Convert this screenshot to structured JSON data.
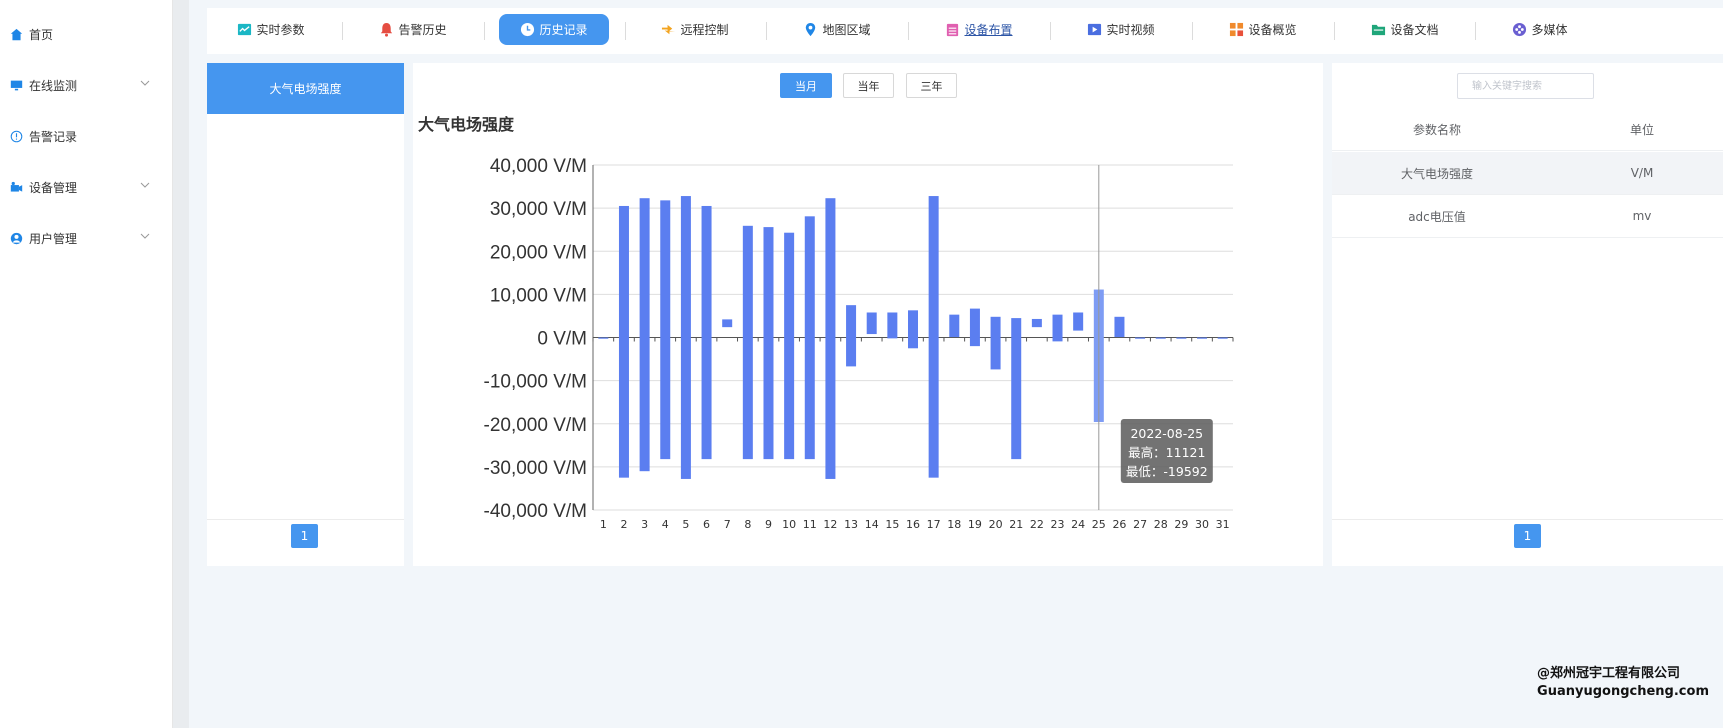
{
  "sidebar": {
    "items": [
      {
        "label": "首页",
        "icon": "home-icon",
        "has_arrow": false
      },
      {
        "label": "在线监测",
        "icon": "monitor-icon",
        "has_arrow": true
      },
      {
        "label": "告警记录",
        "icon": "info-circle-icon",
        "has_arrow": false
      },
      {
        "label": "设备管理",
        "icon": "device-icon",
        "has_arrow": true
      },
      {
        "label": "用户管理",
        "icon": "user-icon",
        "has_arrow": true
      }
    ]
  },
  "toolbar": {
    "tabs": [
      {
        "label": "实时参数",
        "icon": "realtime-params-icon",
        "color": "#1bb7c5"
      },
      {
        "label": "告警历史",
        "icon": "alarm-bell-icon",
        "color": "#e54d42"
      },
      {
        "label": "历史记录",
        "icon": "clock-icon",
        "color": "#ffffff",
        "active": true
      },
      {
        "label": "远程控制",
        "icon": "remote-control-icon",
        "color": "#f3a420"
      },
      {
        "label": "地图区域",
        "icon": "map-pin-icon",
        "color": "#1f86e6"
      },
      {
        "label": "设备布置",
        "icon": "calendar-icon",
        "color": "#e05fb0",
        "underline": true
      },
      {
        "label": "实时视频",
        "icon": "video-icon",
        "color": "#4a6ee0"
      },
      {
        "label": "设备概览",
        "icon": "grid-icon",
        "color": "#f08a2c"
      },
      {
        "label": "设备文档",
        "icon": "folder-icon",
        "color": "#1fa67a"
      },
      {
        "label": "多媒体",
        "icon": "multimedia-icon",
        "color": "#6a5fd1"
      }
    ]
  },
  "left_panel": {
    "items": [
      "大气电场强度"
    ],
    "page": "1"
  },
  "center_panel": {
    "range_buttons": [
      "当月",
      "当年",
      "三年"
    ],
    "active_range": "当月",
    "chart_title": "大气电场强度"
  },
  "right_panel": {
    "search_placeholder": "输入关键字搜索",
    "columns": [
      "参数名称",
      "单位"
    ],
    "rows": [
      {
        "name": "大气电场强度",
        "unit": "V/M",
        "selected": true
      },
      {
        "name": "adc电压值",
        "unit": "mv",
        "selected": false
      }
    ],
    "page": "1"
  },
  "watermark": {
    "line1": "@郑州冠宇工程有限公司",
    "line2": "Guanyugongcheng.com"
  },
  "chart_data": {
    "type": "bar",
    "subtype": "floating-range",
    "title": "大气电场强度",
    "categories": [
      "1",
      "2",
      "3",
      "4",
      "5",
      "6",
      "7",
      "8",
      "9",
      "10",
      "11",
      "12",
      "13",
      "14",
      "15",
      "16",
      "17",
      "18",
      "19",
      "20",
      "21",
      "22",
      "23",
      "24",
      "25",
      "26",
      "27",
      "28",
      "29",
      "30",
      "31"
    ],
    "series": [
      {
        "name": "最高",
        "values": [
          0,
          30500,
          32300,
          31800,
          32800,
          30500,
          4200,
          25900,
          25600,
          24300,
          28100,
          32300,
          7500,
          5800,
          5800,
          6300,
          32800,
          5300,
          6700,
          4800,
          4500,
          4300,
          5300,
          5800,
          11121,
          4800,
          0,
          0,
          0,
          0,
          0
        ]
      },
      {
        "name": "最低",
        "values": [
          0,
          -32500,
          -31000,
          -28200,
          -32800,
          -28200,
          2400,
          -28200,
          -28200,
          -28200,
          -28200,
          -32800,
          -6700,
          800,
          -200,
          -2500,
          -32500,
          100,
          -2000,
          -7400,
          -28200,
          2400,
          -900,
          1600,
          -19592,
          100,
          0,
          0,
          0,
          0,
          0
        ]
      }
    ],
    "ytick_labels": [
      "40,000 V/M",
      "30,000 V/M",
      "20,000 V/M",
      "10,000 V/M",
      "0 V/M",
      "-10,000 V/M",
      "-20,000 V/M",
      "-30,000 V/M",
      "-40,000 V/M"
    ],
    "ylim": [
      -40000,
      40000
    ],
    "yticks": [
      40000,
      30000,
      20000,
      10000,
      0,
      -10000,
      -20000,
      -30000,
      -40000
    ],
    "grid": true,
    "bar_color": "#5b7ef0",
    "highlight_color": "#7e9cf4",
    "tooltip": {
      "category_index": 24,
      "date": "2022-08-25",
      "max_label": "最高：11121",
      "min_label": "最低：-19592"
    }
  },
  "colors": {
    "accent": "#4596ef",
    "page_bg": "#f2f6fa"
  }
}
